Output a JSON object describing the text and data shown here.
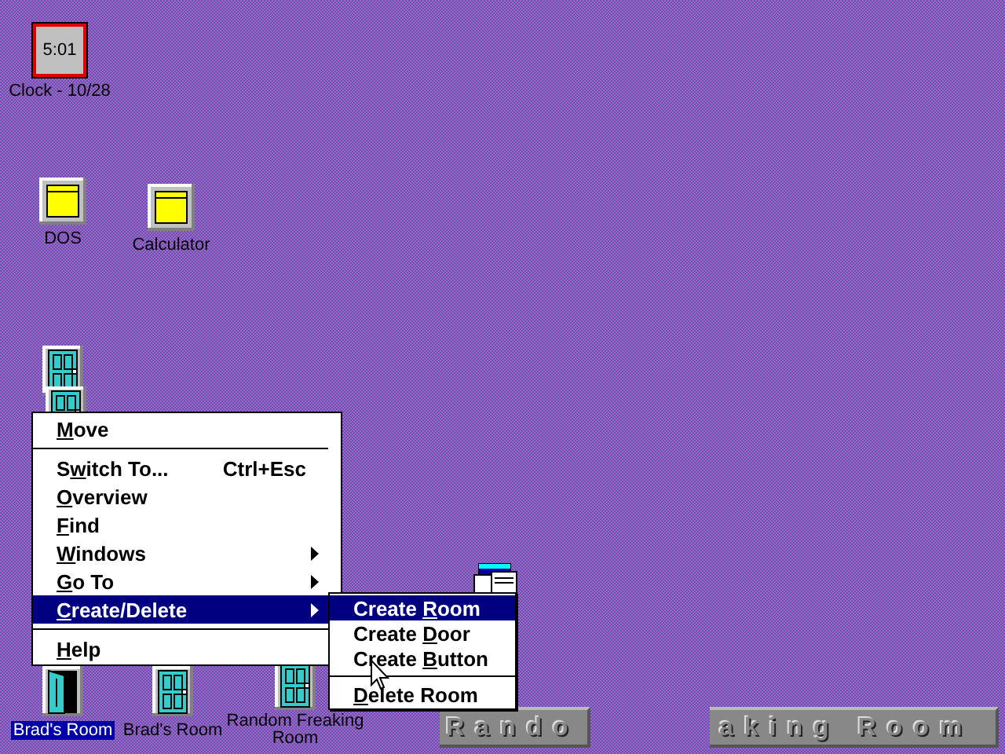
{
  "desktop_icons": [
    {
      "kind": "clock",
      "face": "5:01",
      "label": "Clock - 10/28"
    },
    {
      "kind": "app",
      "label": "DOS",
      "selected": false
    },
    {
      "kind": "app",
      "label": "Calculator",
      "selected": false
    },
    {
      "kind": "door",
      "open": false
    },
    {
      "kind": "door",
      "open": false
    },
    {
      "kind": "window"
    },
    {
      "kind": "door",
      "open": true,
      "label": "Brad's Room",
      "selected": true
    },
    {
      "kind": "door",
      "open": false,
      "label": "Brad's Room",
      "selected": false
    },
    {
      "kind": "door",
      "open": false,
      "label": "Random Freaking Room",
      "selected": false
    }
  ],
  "banner": [
    "Rando",
    "aking Room"
  ],
  "menu": [
    {
      "kind": "item",
      "label": {
        "key": "M",
        "after": "ove"
      },
      "selected": false
    },
    {
      "kind": "separator"
    },
    {
      "kind": "item",
      "label": {
        "before": "S",
        "key": "w",
        "after": "itch To..."
      },
      "shortcut": "Ctrl+Esc",
      "selected": false
    },
    {
      "kind": "item",
      "label": {
        "key": "O",
        "after": "verview"
      },
      "selected": false
    },
    {
      "kind": "item",
      "label": {
        "key": "F",
        "after": "ind"
      },
      "selected": false
    },
    {
      "kind": "submenu",
      "label": {
        "key": "W",
        "after": "indows"
      },
      "selected": false
    },
    {
      "kind": "submenu",
      "label": {
        "key": "G",
        "after": "o To"
      },
      "selected": false
    },
    {
      "kind": "submenu",
      "label": {
        "key": "C",
        "after": "reate/Delete"
      },
      "selected": true
    },
    {
      "kind": "separator"
    },
    {
      "kind": "item",
      "label": {
        "key": "H",
        "after": "elp"
      },
      "selected": false
    }
  ],
  "submenu": [
    {
      "kind": "item",
      "label": {
        "before": "Create ",
        "key": "R",
        "after": "oom"
      },
      "selected": true
    },
    {
      "kind": "item",
      "label": {
        "before": "Create ",
        "key": "D",
        "after": "oor"
      },
      "selected": false
    },
    {
      "kind": "item",
      "label": {
        "before": "Create ",
        "key": "B",
        "after": "utton"
      },
      "selected": false
    },
    {
      "kind": "separator"
    },
    {
      "kind": "item",
      "label": {
        "key": "D",
        "after": "elete Room"
      },
      "selected": false
    }
  ]
}
